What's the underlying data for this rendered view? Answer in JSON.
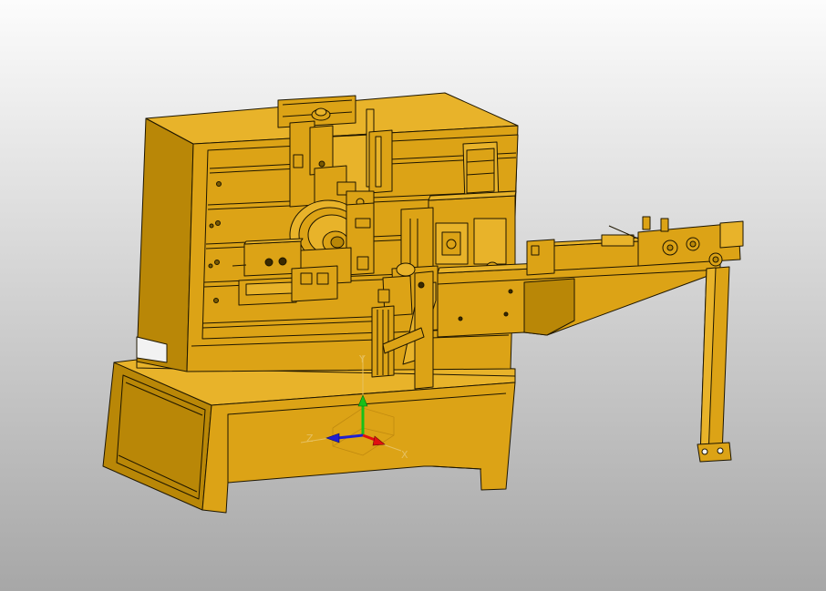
{
  "viewport": {
    "background_top": "#fcfcfc",
    "background_bottom": "#a7a7a7"
  },
  "model": {
    "body_color": "#dca316",
    "light_color": "#e8b32a",
    "dark_color": "#b98707",
    "edge_color": "#1e1600"
  },
  "triad": {
    "x_label": "X",
    "y_label": "Y",
    "z_label": "Z",
    "x_color": "#e01010",
    "y_color": "#18c018",
    "z_color": "#2020d0",
    "x_icon": "triad-x-axis-icon",
    "y_icon": "triad-y-axis-icon",
    "z_icon": "triad-z-axis-icon"
  }
}
